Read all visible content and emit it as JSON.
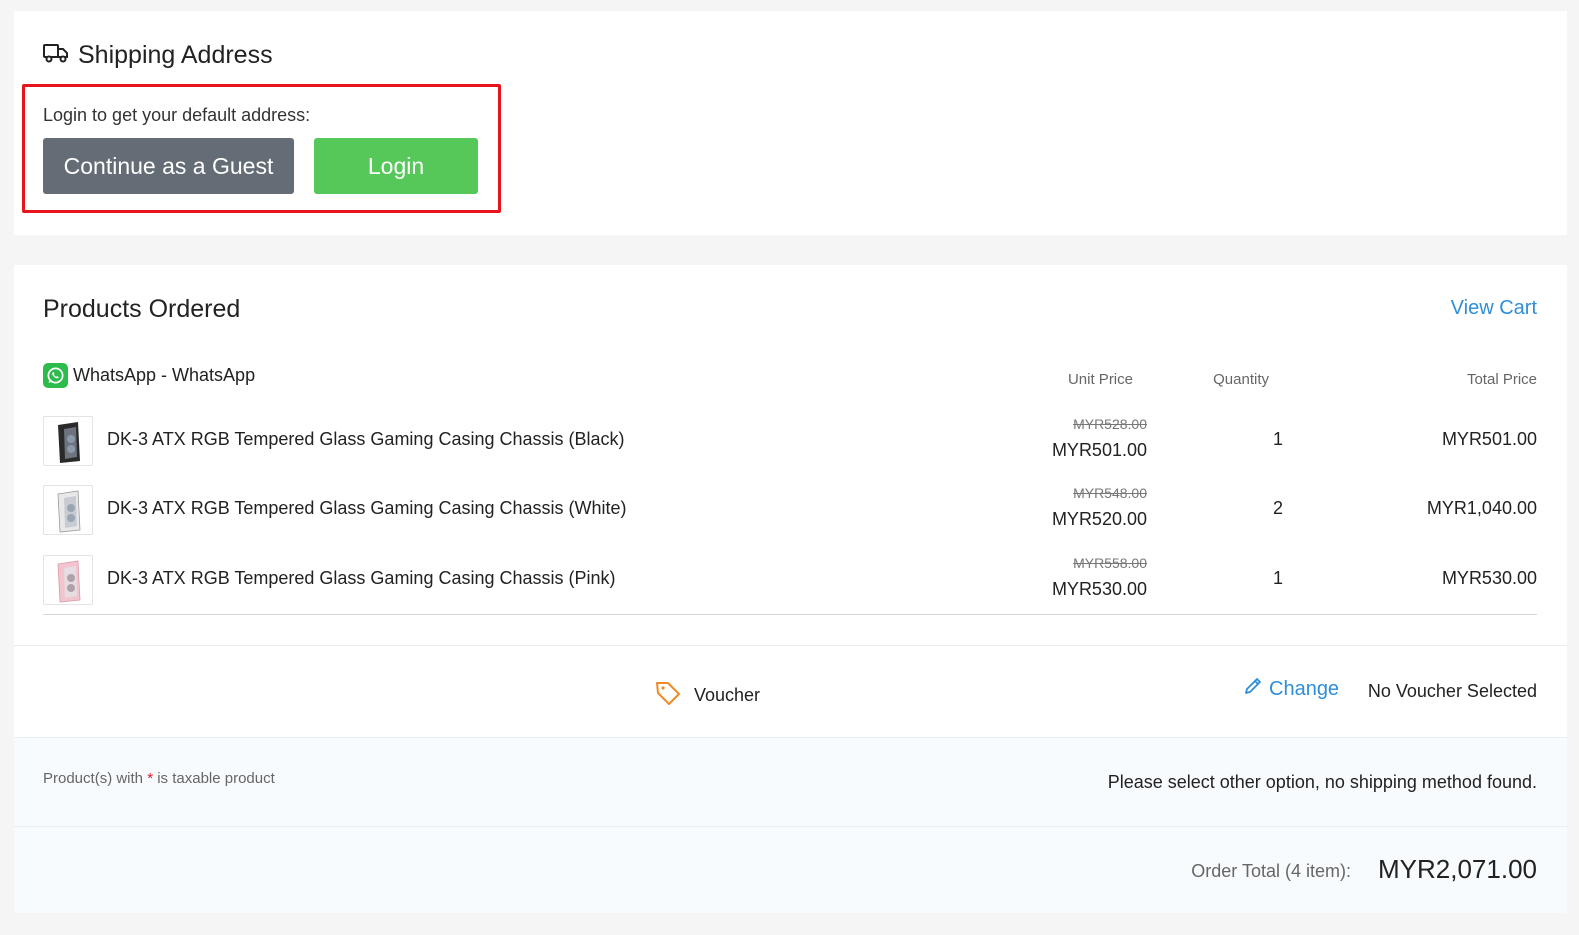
{
  "shipping": {
    "title": "Shipping Address",
    "login_hint": "Login to get your default address:",
    "guest_button": "Continue as a Guest",
    "login_button": "Login"
  },
  "products": {
    "title": "Products Ordered",
    "view_cart": "View Cart",
    "shop_name": "WhatsApp - WhatsApp",
    "columns": {
      "unit_price": "Unit Price",
      "quantity": "Quantity",
      "total_price": "Total Price"
    },
    "items": [
      {
        "name": "DK-3 ATX RGB Tempered Glass Gaming Casing Chassis (Black)",
        "old_price": "MYR528.00",
        "price": "MYR501.00",
        "qty": "1",
        "total": "MYR501.00"
      },
      {
        "name": "DK-3 ATX RGB Tempered Glass Gaming Casing Chassis (White)",
        "old_price": "MYR548.00",
        "price": "MYR520.00",
        "qty": "2",
        "total": "MYR1,040.00"
      },
      {
        "name": "DK-3 ATX RGB Tempered Glass Gaming Casing Chassis (Pink)",
        "old_price": "MYR558.00",
        "price": "MYR530.00",
        "qty": "1",
        "total": "MYR530.00"
      }
    ]
  },
  "voucher": {
    "label": "Voucher",
    "change": "Change",
    "status": "No Voucher Selected"
  },
  "tax": {
    "note_prefix": "Product(s) with",
    "star": "*",
    "note_suffix": "is taxable product",
    "shipping_message": "Please select other option, no shipping method found."
  },
  "order_total": {
    "label": "Order Total (4 item):",
    "value": "MYR2,071.00"
  },
  "colors": {
    "accent": "#2f8ed8",
    "login_green": "#56c85a",
    "guest_gray": "#646d76",
    "highlight_red": "#e8141d",
    "voucher_orange": "#f08a24"
  }
}
